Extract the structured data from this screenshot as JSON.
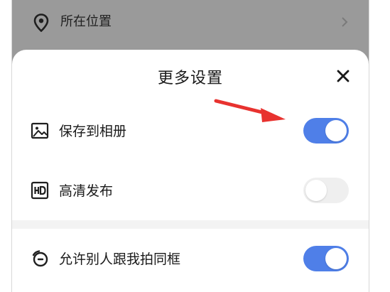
{
  "location": {
    "label": "所在位置",
    "icon": "location-pin-icon"
  },
  "sheet": {
    "title": "更多设置",
    "close_icon": "close-icon",
    "options": [
      {
        "label": "保存到相册",
        "icon": "image-icon",
        "enabled": true
      },
      {
        "label": "高清发布",
        "icon": "hd-icon",
        "enabled": false
      },
      {
        "label": "允许别人跟我拍同框",
        "icon": "duet-icon",
        "enabled": true
      }
    ]
  },
  "colors": {
    "toggle_on": "#4f7fe8",
    "toggle_off": "#efefef",
    "annotation_arrow": "#e8322f",
    "overlay": "#9a9a9a"
  }
}
